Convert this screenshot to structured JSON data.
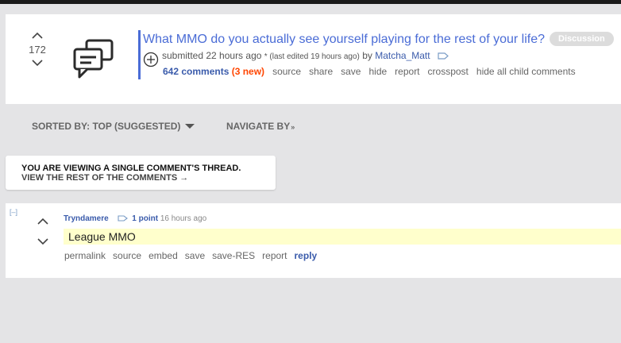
{
  "post": {
    "score": "172",
    "title": "What MMO do you actually see yourself playing for the rest of your life?",
    "flair": "Discussion",
    "tagline": {
      "submitted": "submitted 22 hours ago",
      "edited": "* (last edited 19 hours ago)",
      "by": "by",
      "author": "Matcha_Matt"
    },
    "buttons": {
      "comments": "642 comments",
      "new": "(3 new)",
      "source": "source",
      "share": "share",
      "save": "save",
      "hide": "hide",
      "report": "report",
      "crosspost": "crosspost",
      "hide_children": "hide all child comments"
    }
  },
  "sortbar": {
    "sorted": "SORTED BY: TOP (SUGGESTED)",
    "navigate": "NAVIGATE BY"
  },
  "notice": {
    "line1": "YOU ARE VIEWING A SINGLE COMMENT'S THREAD.",
    "line2": "VIEW THE REST OF THE COMMENTS →"
  },
  "comment": {
    "collapse": "[–]",
    "author": "Tryndamere",
    "points": "1 point",
    "time": "16 hours ago",
    "body": "League MMO",
    "buttons": {
      "permalink": "permalink",
      "source": "source",
      "embed": "embed",
      "save": "save",
      "save_res": "save-RES",
      "report": "report",
      "reply": "reply"
    }
  },
  "colors": {
    "link": "#4a6cd6",
    "new": "#ff4500",
    "highlight": "#ffffcc",
    "page_bg": "#e4e4e6"
  },
  "icons": [
    "upvote-icon",
    "downvote-icon",
    "comments-thumbnail-icon",
    "expando-plus-icon",
    "tag-icon",
    "caret-down-icon"
  ]
}
